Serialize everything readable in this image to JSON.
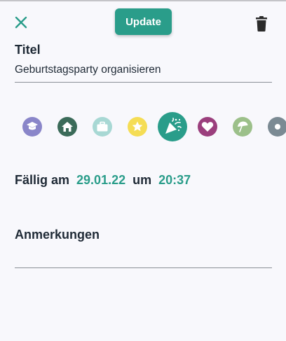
{
  "toolbar": {
    "close_icon": "close-icon",
    "update_label": "Update",
    "delete_icon": "trash-icon"
  },
  "title": {
    "label": "Titel",
    "value": "Geburtstagsparty organisieren"
  },
  "categories": [
    {
      "icon": "graduation-cap-icon",
      "color": "#8a86c9",
      "selected": false
    },
    {
      "icon": "home-icon",
      "color": "#3b6b59",
      "selected": false
    },
    {
      "icon": "briefcase-icon",
      "color": "#a8d8d4",
      "selected": false
    },
    {
      "icon": "star-icon",
      "color": "#f5dd55",
      "selected": false
    },
    {
      "icon": "party-popper-icon",
      "color": "#2a9d8a",
      "selected": true
    },
    {
      "icon": "heart-icon",
      "color": "#9b3f7d",
      "selected": false
    },
    {
      "icon": "beach-umbrella-icon",
      "color": "#9cc08a",
      "selected": false
    },
    {
      "icon": "category-icon",
      "color": "#7b8a93",
      "selected": false
    }
  ],
  "due": {
    "label": "Fällig am",
    "date": "29.01.22",
    "connector": "um",
    "time": "20:37"
  },
  "notes": {
    "label": "Anmerkungen",
    "value": ""
  },
  "colors": {
    "accent": "#2a9d8a",
    "background": "#f8f8fc",
    "text": "#1f2a36"
  }
}
